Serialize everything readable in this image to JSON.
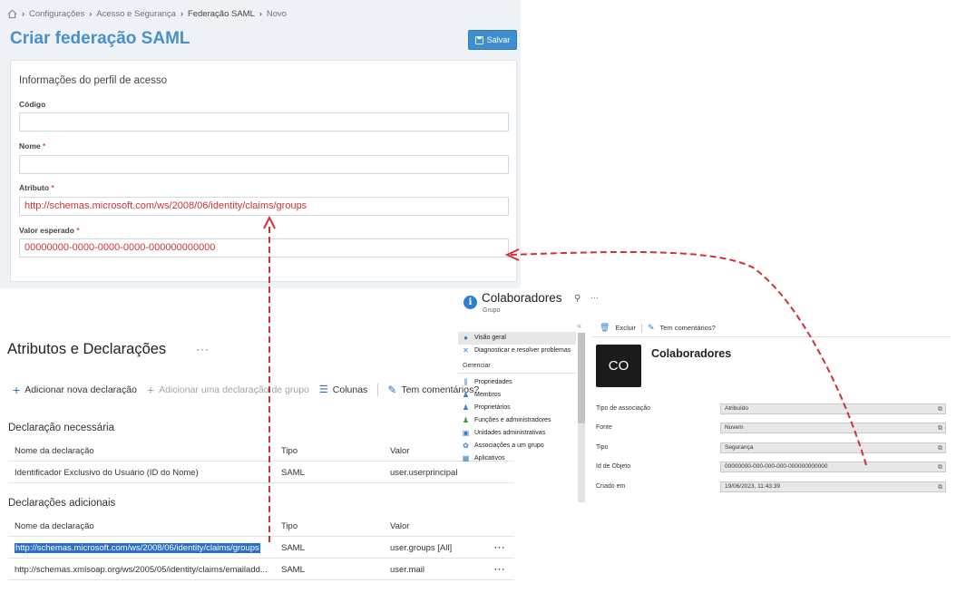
{
  "form": {
    "breadcrumb": [
      "Configurações",
      "Acesso e Segurança",
      "Federação SAML",
      "Novo"
    ],
    "title": "Criar federação SAML",
    "save_label": "Salvar",
    "card_title": "Informações do perfil de acesso",
    "fields": {
      "codigo": {
        "label": "Código",
        "required": "",
        "value": ""
      },
      "nome": {
        "label": "Nome",
        "required": "*",
        "value": ""
      },
      "atributo": {
        "label": "Atributo",
        "required": "*",
        "value": "http://schemas.microsoft.com/ws/2008/06/identity/claims/groups"
      },
      "valor": {
        "label": "Valor esperado",
        "required": "*",
        "value": "00000000-0000-0000-0000-000000000000"
      }
    }
  },
  "attributes": {
    "title": "Atributos e Declarações",
    "more": "···",
    "toolbar": {
      "add_claim": "Adicionar nova declaração",
      "add_group_claim": "Adicionar uma declaração de grupo",
      "columns": "Colunas",
      "feedback": "Tem comentários?"
    },
    "required_section": "Declaração necessária",
    "additional_section": "Declarações adicionais",
    "headers": {
      "name": "Nome da declaração",
      "type": "Tipo",
      "value": "Valor"
    },
    "required_rows": [
      {
        "name": "Identificador Exclusivo do Usuário (ID do Nome)",
        "type": "SAML",
        "value": "user.userprincipal"
      }
    ],
    "additional_rows": [
      {
        "name": "http://schemas.microsoft.com/ws/2008/06/identity/claims/groups",
        "type": "SAML",
        "value": "user.groups [All]",
        "menu": "···"
      },
      {
        "name": "http://schemas.xmlsoap.org/ws/2005/05/identity/claims/emailadd...",
        "type": "SAML",
        "value": "user.mail",
        "menu": "···"
      }
    ]
  },
  "group": {
    "title": "Colaboradores",
    "subtitle": "Grupo",
    "collapse": "«",
    "nav": {
      "overview": "Visão geral",
      "diagnose": "Diagnosticar e resolver problemas",
      "manage_section": "Gerenciar",
      "properties": "Propriedades",
      "members": "Membros",
      "owners": "Proprietários",
      "roles": "Funções e administradores",
      "admin_units": "Unidades administrativas",
      "group_assoc": "Associações a um grupo",
      "apps": "Aplicativos"
    },
    "commands": {
      "delete": "Excluir",
      "feedback": "Tem comentários?"
    },
    "avatar": "CO",
    "name": "Colaboradores",
    "properties": {
      "membership_type": {
        "label": "Tipo de associação",
        "value": "Atribuído"
      },
      "source": {
        "label": "Fonte",
        "value": "Nuvem"
      },
      "type": {
        "label": "Tipo",
        "value": "Segurança"
      },
      "object_id": {
        "label": "Id de Objeto",
        "value": "00000000-000-000-000-000000000000"
      },
      "created": {
        "label": "Criado em",
        "value": "19/06/2023, 11:43:39"
      }
    }
  },
  "colors": {
    "accent": "#4a90c8",
    "save_button": "#3f8fd0",
    "field_text": "#d0323a",
    "arrow": "#d0323a",
    "selection": "#2a6fc9"
  }
}
